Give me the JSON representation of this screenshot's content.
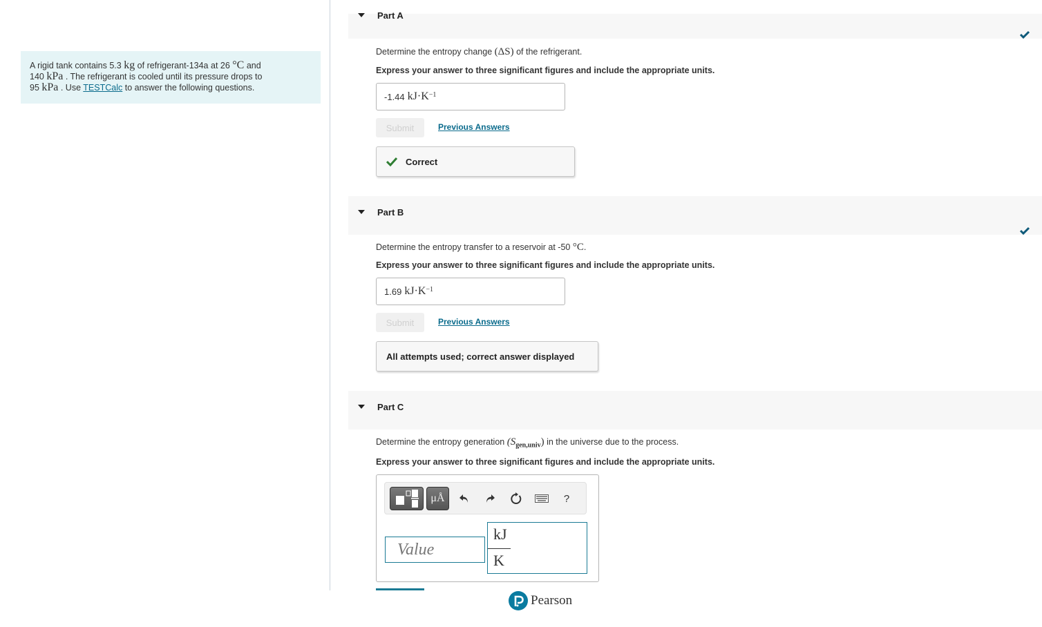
{
  "problem": {
    "text_1": "A rigid tank contains 5.3 ",
    "unit_kg": "kg",
    "text_2": " of refrigerant-134a at 26 ",
    "unit_c": "°C",
    "text_3": " and",
    "value_p1": "140 ",
    "unit_kpa1": "kPa",
    "text_4": " . The refrigerant is cooled until its pressure drops to",
    "value_p2": "95 ",
    "unit_kpa2": "kPa",
    "text_5": " . Use ",
    "link": "TESTCalc",
    "text_6": " to answer the following questions."
  },
  "parts": [
    {
      "title": "Part A",
      "question_pre": "Determine the entropy change ",
      "question_math": "(ΔS)",
      "question_post": " of the refrigerant.",
      "instruction": "Express your answer to three significant figures and include the appropriate units.",
      "answer_value": "-1.44",
      "answer_unit": "kJ·K",
      "answer_exp": "−1",
      "submit_label": "Submit",
      "previous_answers_label": "Previous Answers",
      "feedback": "Correct",
      "completed": true
    },
    {
      "title": "Part B",
      "question_pre": "Determine the entropy transfer to a reservoir at -50 ",
      "question_math": "°C",
      "question_post": ".",
      "instruction": "Express your answer to three significant figures and include the appropriate units.",
      "answer_value": "1.69",
      "answer_unit": "kJ·K",
      "answer_exp": "−1",
      "submit_label": "Submit",
      "previous_answers_label": "Previous Answers",
      "feedback": "All attempts used; correct answer displayed",
      "completed": true
    },
    {
      "title": "Part C",
      "question_pre": "Determine the entropy generation ",
      "question_math_S": "(S",
      "question_math_sub": "gen,univ",
      "question_math_close": ")",
      "question_post": " in the universe due to the process.",
      "instruction": "Express your answer to three significant figures and include the appropriate units.",
      "value_placeholder": "Value",
      "unit_numerator": "kJ",
      "unit_denominator": "K",
      "completed": false
    }
  ],
  "toolbar": {
    "units_button_label": "μÅ",
    "help_label": "?"
  },
  "footer": {
    "brand": "Pearson"
  },
  "colors": {
    "accent": "#1a7a94",
    "link": "#0a6b8c",
    "correct_green": "#2e7d32",
    "header_bg": "#f7f7f7",
    "problem_bg": "#e5f4f6"
  }
}
